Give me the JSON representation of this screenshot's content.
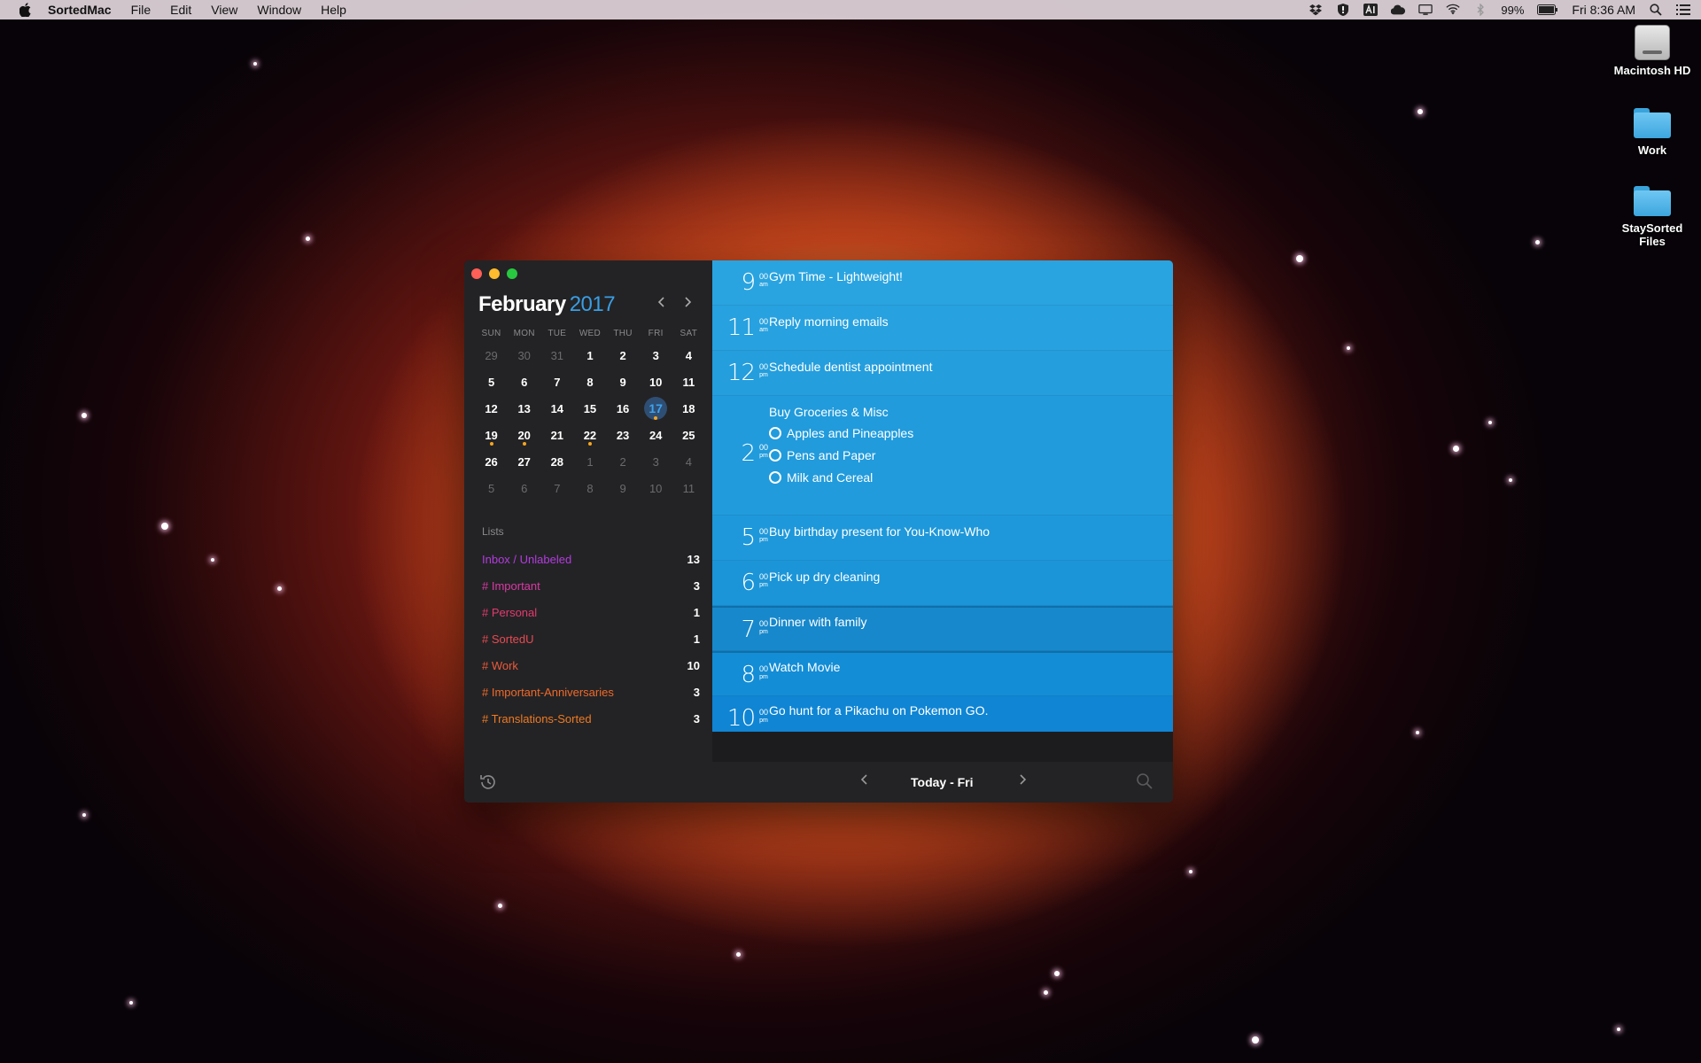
{
  "menubar": {
    "app_name": "SortedMac",
    "menus": [
      "File",
      "Edit",
      "View",
      "Window",
      "Help"
    ],
    "battery": "99%",
    "clock": "Fri 8:36 AM"
  },
  "desktop": {
    "icons": [
      {
        "label": "Macintosh HD",
        "icon": "hard-drive-icon"
      },
      {
        "label": "Work",
        "icon": "folder-icon"
      },
      {
        "label": "StaySorted Files",
        "icon": "folder-icon"
      }
    ]
  },
  "calendar": {
    "month": "February",
    "year": "2017",
    "weekdays": [
      "SUN",
      "MON",
      "TUE",
      "WED",
      "THU",
      "FRI",
      "SAT"
    ],
    "weeks": [
      [
        "29",
        "30",
        "31",
        "1",
        "2",
        "3",
        "4"
      ],
      [
        "5",
        "6",
        "7",
        "8",
        "9",
        "10",
        "11"
      ],
      [
        "12",
        "13",
        "14",
        "15",
        "16",
        "17",
        "18"
      ],
      [
        "19",
        "20",
        "21",
        "22",
        "23",
        "24",
        "25"
      ],
      [
        "26",
        "27",
        "28",
        "1",
        "2",
        "3",
        "4"
      ],
      [
        "5",
        "6",
        "7",
        "8",
        "9",
        "10",
        "11"
      ]
    ],
    "today": "17",
    "accent_color": "#3a9ee4",
    "event_dot_color": "#f5a623"
  },
  "lists": {
    "title": "Lists",
    "items": [
      {
        "label": "Inbox / Unlabeled",
        "count": "13",
        "color": "#b43be0"
      },
      {
        "label": "# Important",
        "count": "3",
        "color": "#d93aa4"
      },
      {
        "label": "# Personal",
        "count": "1",
        "color": "#e43a6e"
      },
      {
        "label": "# SortedU",
        "count": "1",
        "color": "#e84a52"
      },
      {
        "label": "# Work",
        "count": "10",
        "color": "#ec5a3a"
      },
      {
        "label": "# Important-Anniversaries",
        "count": "3",
        "color": "#ef6a2a"
      },
      {
        "label": "# Translations-Sorted",
        "count": "3",
        "color": "#f07a22"
      }
    ]
  },
  "agenda": {
    "slots": [
      {
        "hour": "9",
        "min": "00",
        "ampm": "am",
        "title": "Gym Time - Lightweight!"
      },
      {
        "hour": "11",
        "min": "00",
        "ampm": "am",
        "title": "Reply morning emails"
      },
      {
        "hour": "12",
        "min": "00",
        "ampm": "pm",
        "title": "Schedule dentist appointment"
      },
      {
        "hour": "2",
        "min": "00",
        "ampm": "pm",
        "title": "Buy Groceries & Misc",
        "subtasks": [
          "Apples and Pineapples",
          "Pens and Paper",
          "Milk and Cereal"
        ]
      },
      {
        "hour": "5",
        "min": "00",
        "ampm": "pm",
        "title": "Buy birthday present for You-Know-Who"
      },
      {
        "hour": "6",
        "min": "00",
        "ampm": "pm",
        "title": "Pick up dry cleaning"
      },
      {
        "hour": "7",
        "min": "00",
        "ampm": "pm",
        "title": "Dinner with family"
      },
      {
        "hour": "8",
        "min": "00",
        "ampm": "pm",
        "title": "Watch Movie"
      },
      {
        "hour": "10",
        "min": "00",
        "ampm": "pm",
        "title": "Go hunt for a Pikachu on Pokemon GO."
      }
    ]
  },
  "footer": {
    "day_label": "Today - Fri"
  }
}
